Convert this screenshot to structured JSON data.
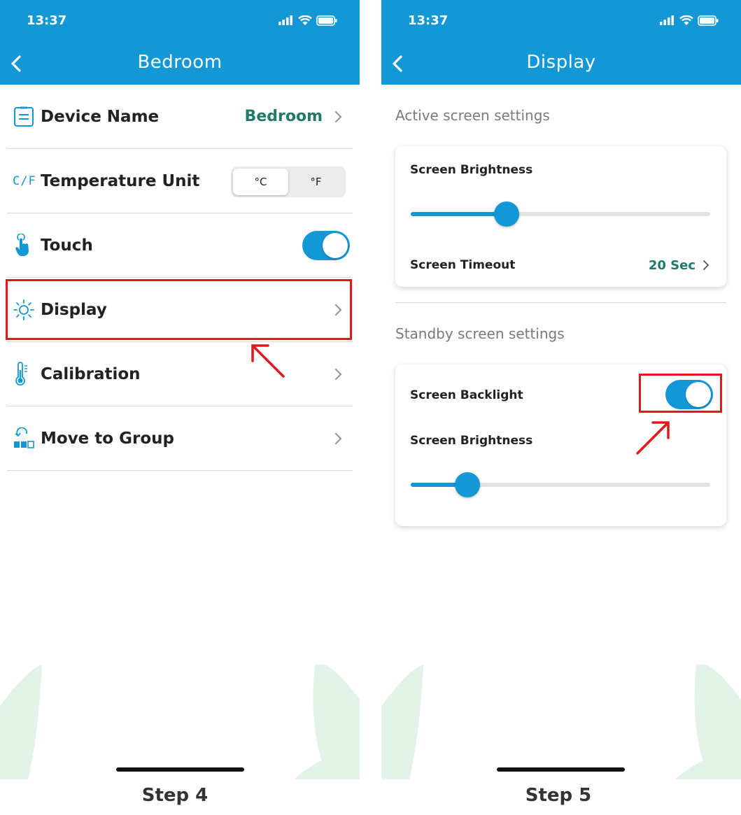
{
  "colors": {
    "accent": "#1397d5",
    "value_green": "#1f7a6a",
    "highlight_red": "#e01818",
    "leaf_green": "#e3f3e7"
  },
  "status_bar": {
    "time": "13:37",
    "icons": [
      "signal-icon",
      "wifi-icon",
      "battery-icon"
    ]
  },
  "step4": {
    "nav": {
      "title": "Bedroom"
    },
    "rows": [
      {
        "icon": "document-icon",
        "label": "Device Name",
        "value": "Bedroom"
      },
      {
        "icon": "cf-icon",
        "icon_text": "C/F",
        "label": "Temperature Unit",
        "options": [
          "°C",
          "°F"
        ],
        "selected": "°C"
      },
      {
        "icon": "touch-icon",
        "label": "Touch",
        "toggle": true
      },
      {
        "icon": "sun-icon",
        "label": "Display",
        "highlighted": true
      },
      {
        "icon": "thermometer-icon",
        "label": "Calibration"
      },
      {
        "icon": "move-group-icon",
        "label": "Move to Group"
      }
    ],
    "caption": "Step 4"
  },
  "step5": {
    "nav": {
      "title": "Display"
    },
    "active_section": {
      "title": "Active screen settings",
      "brightness_label": "Screen Brightness",
      "brightness_level": 0.32,
      "timeout_label": "Screen Timeout",
      "timeout_value": "20 Sec"
    },
    "standby_section": {
      "title": "Standby screen settings",
      "backlight_label": "Screen Backlight",
      "backlight_on": true,
      "brightness_label": "Screen Brightness",
      "brightness_level": 0.19
    },
    "caption": "Step 5"
  }
}
